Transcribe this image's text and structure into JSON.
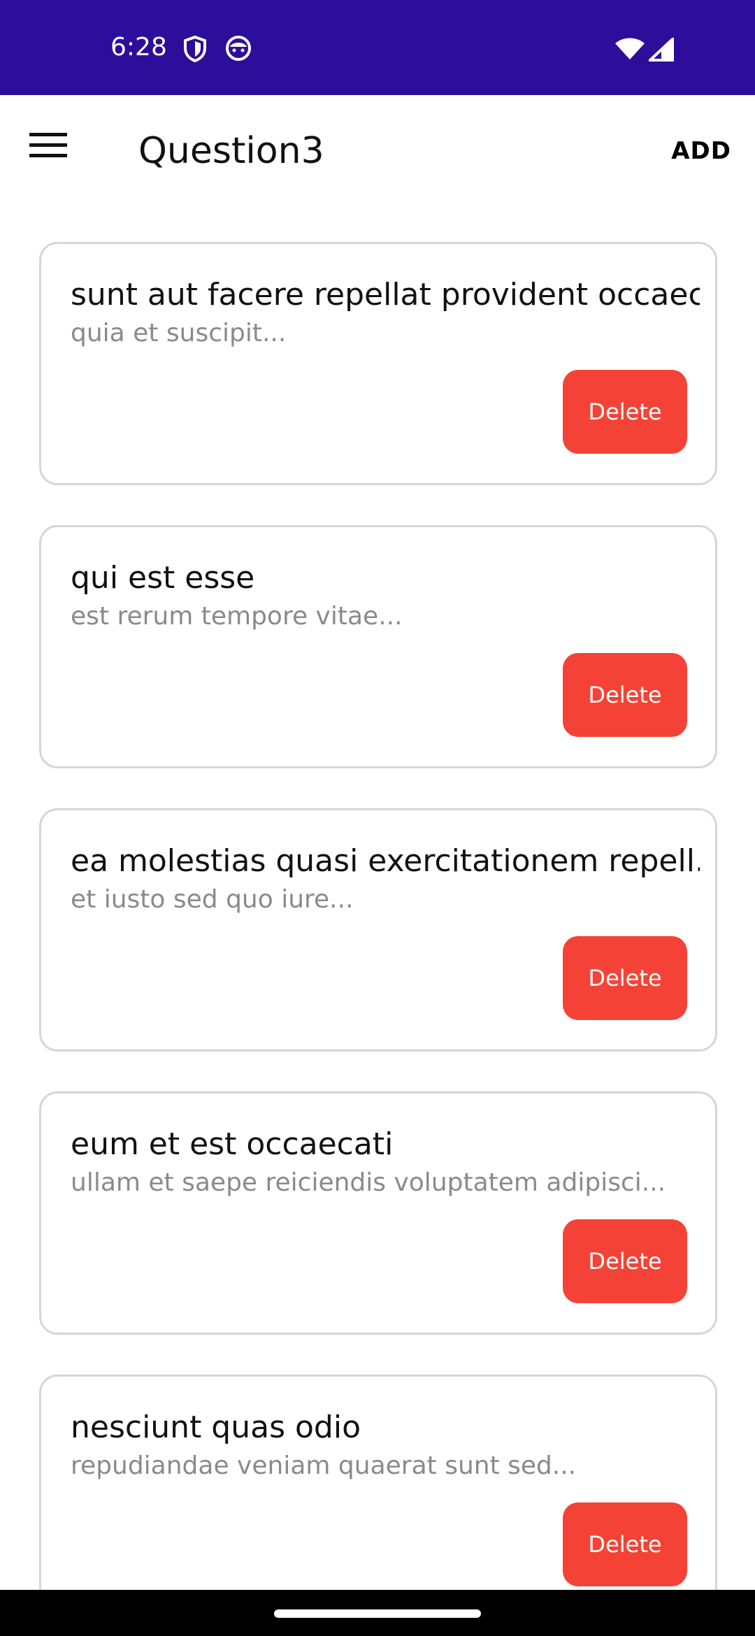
{
  "status_bar": {
    "time": "6:28",
    "icons": [
      "shield-icon",
      "notification-face-icon",
      "wifi-icon",
      "cellular-signal-icon"
    ]
  },
  "app_bar": {
    "title": "Question3",
    "add_label": "ADD",
    "menu_icon": "hamburger-menu-icon"
  },
  "colors": {
    "status_bar": "#2d0e9b",
    "delete_button": "#f44336",
    "card_border": "#d6d6d6",
    "subtitle_text": "#8a8a8a"
  },
  "posts": [
    {
      "title": "sunt aut facere repellat provident occaec...",
      "subtitle": "quia et suscipit...",
      "delete_label": "Delete"
    },
    {
      "title": "qui est esse",
      "subtitle": "est rerum tempore vitae...",
      "delete_label": "Delete"
    },
    {
      "title": "ea molestias quasi exercitationem repell...",
      "subtitle": "et iusto sed quo iure...",
      "delete_label": "Delete"
    },
    {
      "title": "eum et est occaecati",
      "subtitle": "ullam et saepe reiciendis voluptatem adipisci...",
      "delete_label": "Delete"
    },
    {
      "title": "nesciunt quas odio",
      "subtitle": "repudiandae veniam quaerat sunt sed...",
      "delete_label": "Delete"
    }
  ]
}
